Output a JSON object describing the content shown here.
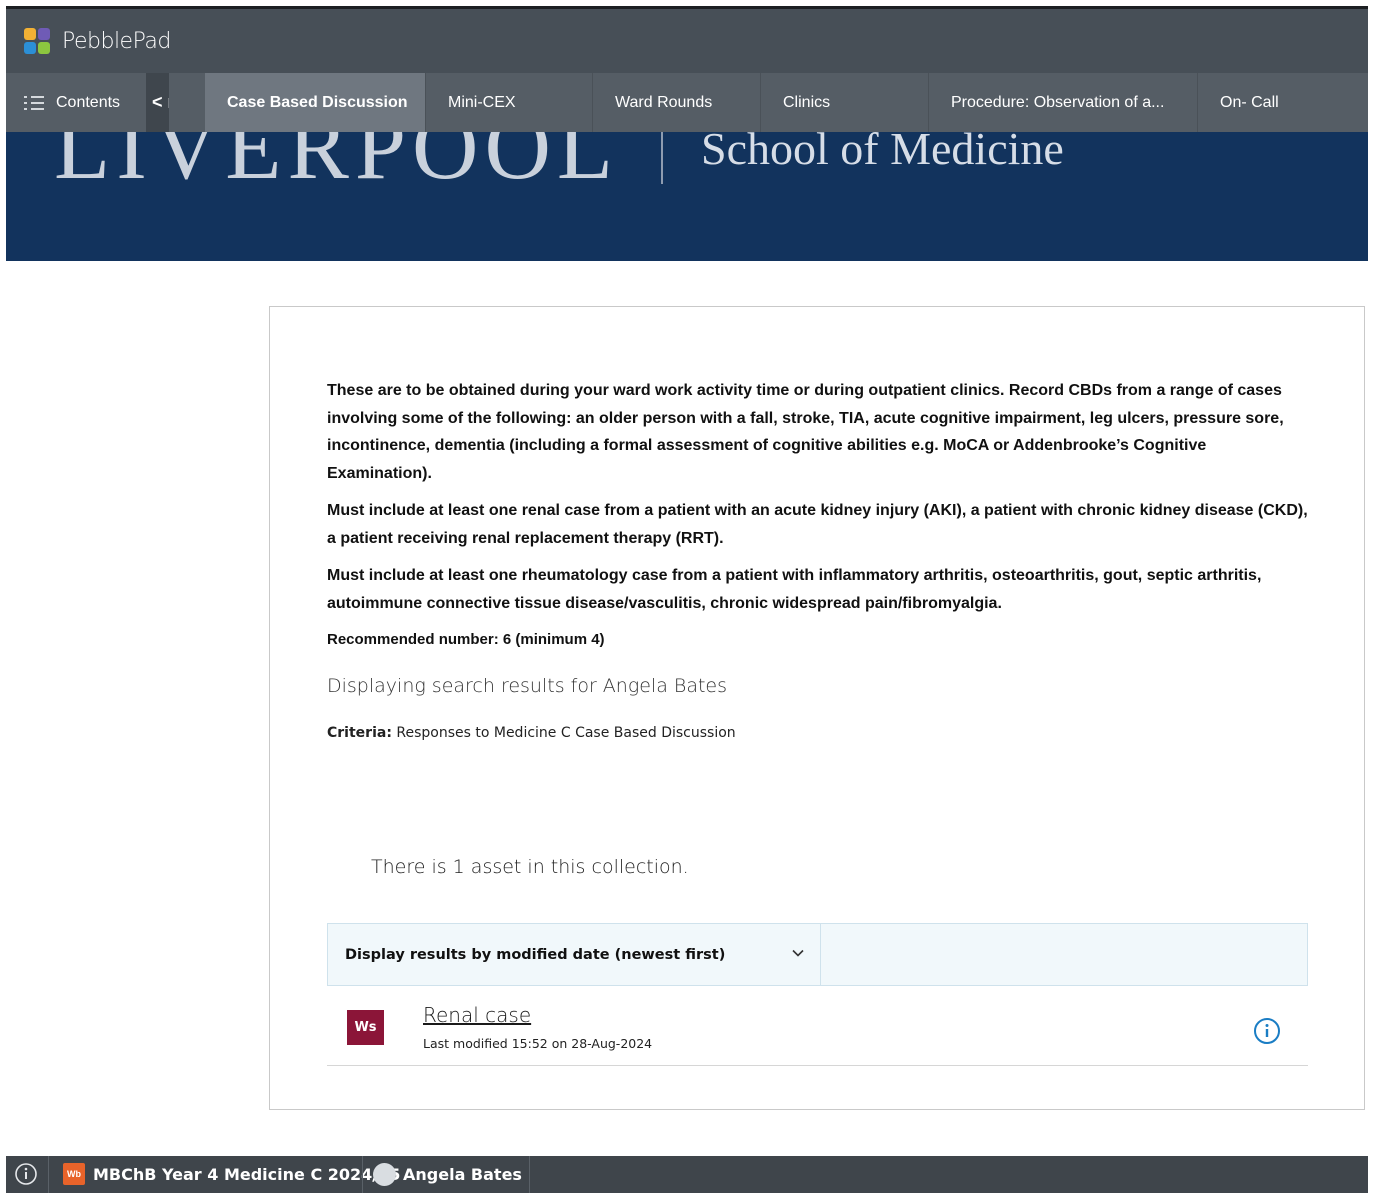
{
  "app": {
    "brand": "PebblePad"
  },
  "nav": {
    "contents_label": "Contents",
    "back_label": "< n",
    "tabs": [
      {
        "label": "Case Based Discussion",
        "active": true
      },
      {
        "label": "Mini-CEX"
      },
      {
        "label": "Ward Rounds"
      },
      {
        "label": "Clinics"
      },
      {
        "label": "Procedure: Observation of a..."
      },
      {
        "label": "On- Call"
      }
    ]
  },
  "banner": {
    "university_text": "LIVERPOOL",
    "school_text": "School of Medicine"
  },
  "content": {
    "paragraphs": [
      "These are to be obtained during your ward work activity time or during outpatient clinics. Record CBDs from a range of cases involving some of the following: an older person with a fall, stroke, TIA, acute cognitive impairment, leg ulcers, pressure sore, incontinence, dementia (including a formal assessment of cognitive abilities e.g. MoCA or Addenbrooke’s Cognitive Examination).",
      "Must include at least one renal case from a patient with an acute kidney injury (AKI), a patient with chronic kidney disease (CKD), a patient receiving renal replacement therapy (RRT).",
      "Must include at least one rheumatology case from a patient with inflammatory arthritis, osteoarthritis, gout, septic arthritis, autoimmune connective tissue disease/vasculitis, chronic widespread pain/fibromyalgia."
    ],
    "recommended": "Recommended number: 6  (minimum 4)",
    "search_heading": "Displaying search results for Angela Bates",
    "criteria_label": "Criteria:",
    "criteria_value": " Responses to Medicine C Case Based Discussion",
    "asset_count": "There is 1 asset in this collection.",
    "sort_label": "Display results by modified date (newest first)",
    "asset": {
      "badge": "Ws",
      "title": "Renal case",
      "meta": "Last modified 15:52 on 28-Aug-2024"
    }
  },
  "footer": {
    "workbook_badge": "Wb",
    "workbook_label": "MBChB Year 4 Medicine C 2024/25",
    "user_name": "Angela Bates"
  },
  "colors": {
    "topbar": "#474f57",
    "navbar": "#555d65",
    "active_tab": "#6f7780",
    "banner": "#12335d",
    "ws_badge": "#8b1538",
    "info_accent": "#1a7dc4",
    "footer": "#3f454b",
    "wb_badge": "#e8632a"
  }
}
